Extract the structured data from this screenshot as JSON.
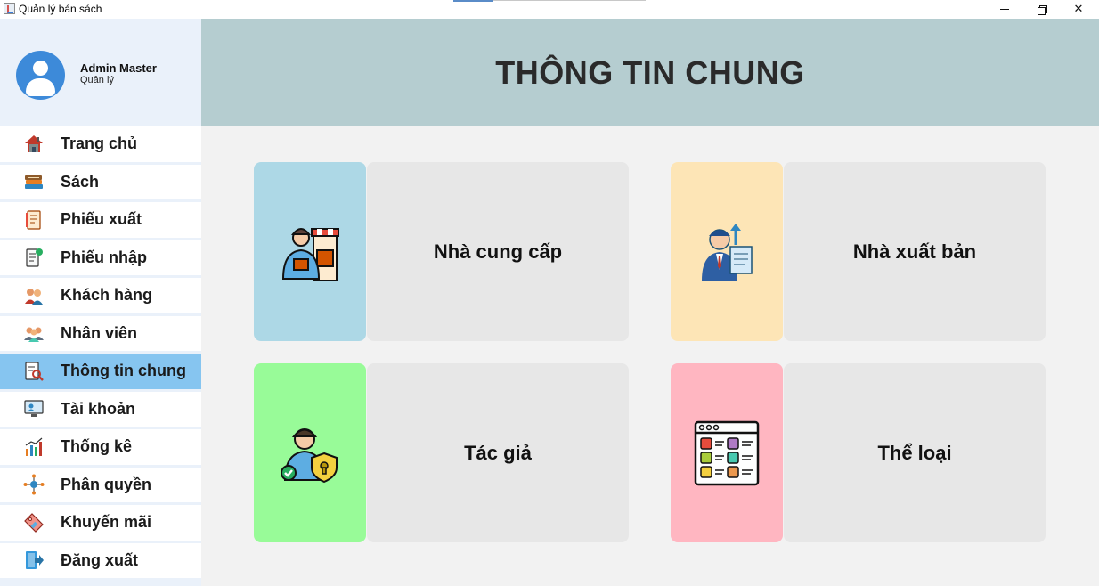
{
  "window": {
    "title": "Quản lý bán sách"
  },
  "user": {
    "name": "Admin Master",
    "role": "Quản lý"
  },
  "menu": [
    {
      "label": "Trang chủ",
      "icon": "home-icon"
    },
    {
      "label": "Sách",
      "icon": "books-icon"
    },
    {
      "label": "Phiếu xuất",
      "icon": "export-receipt-icon"
    },
    {
      "label": "Phiếu nhập",
      "icon": "import-receipt-icon"
    },
    {
      "label": "Khách hàng",
      "icon": "customers-icon"
    },
    {
      "label": "Nhân viên",
      "icon": "employees-icon"
    },
    {
      "label": "Thông tin chung",
      "icon": "general-info-icon",
      "active": true
    },
    {
      "label": "Tài khoản",
      "icon": "account-icon"
    },
    {
      "label": "Thống kê",
      "icon": "statistics-icon"
    },
    {
      "label": "Phân quyền",
      "icon": "permissions-icon"
    },
    {
      "label": "Khuyến mãi",
      "icon": "promotion-icon"
    },
    {
      "label": "Đăng xuất",
      "icon": "logout-icon"
    }
  ],
  "header": {
    "title": "THÔNG TIN CHUNG"
  },
  "cards": [
    {
      "label": "Nhà cung cấp",
      "icon": "supplier-icon",
      "color": "#add8e6"
    },
    {
      "label": "Nhà xuất bản",
      "icon": "publisher-icon",
      "color": "#fde5b6"
    },
    {
      "label": "Tác giả",
      "icon": "author-icon",
      "color": "#98fb98"
    },
    {
      "label": "Thể loại",
      "icon": "category-icon",
      "color": "#ffb6c1"
    }
  ],
  "colors": {
    "sidebar_bg": "#eaf1fa",
    "menu_active": "#86c5f0",
    "header_bg": "#b5cdd0",
    "content_bg": "#f2f2f2",
    "card_label_bg": "#e7e7e7"
  }
}
